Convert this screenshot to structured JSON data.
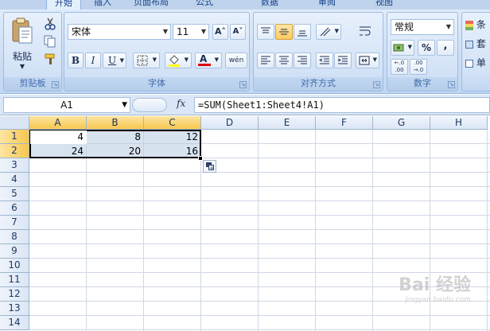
{
  "ribbon": {
    "tabs": [
      "开始",
      "插入",
      "页面布局",
      "公式",
      "数据",
      "审阅",
      "视图"
    ],
    "groups": {
      "clipboard": {
        "label": "剪贴板",
        "paste": "粘贴"
      },
      "font": {
        "label": "字体",
        "font_name": "宋体",
        "font_size": "11",
        "bold": "B",
        "italic": "I",
        "underline": "U",
        "grow": "A˄",
        "shrink": "A˅",
        "font_color": "A",
        "phonetic": "wén"
      },
      "alignment": {
        "label": "对齐方式"
      },
      "number": {
        "label": "数字",
        "format": "常规",
        "percent": "%",
        "comma": ",",
        "inc_decimal": "←.0 .00",
        "dec_decimal": ".00 →.0"
      },
      "styles": {
        "items": [
          "条",
          "套",
          "单"
        ]
      }
    }
  },
  "formula_bar": {
    "name_box": "A1",
    "fx": "fx",
    "formula": "=SUM(Sheet1:Sheet4!A1)"
  },
  "grid": {
    "columns": [
      "A",
      "B",
      "C",
      "D",
      "E",
      "F",
      "G",
      "H"
    ],
    "rows": [
      "1",
      "2",
      "3",
      "4",
      "5",
      "6",
      "7",
      "8",
      "9",
      "10",
      "11",
      "12",
      "13",
      "14"
    ],
    "cells": {
      "A1": "4",
      "B1": "8",
      "C1": "12",
      "A2": "24",
      "B2": "20",
      "C2": "16"
    }
  },
  "watermark": {
    "text": "Bai 经验",
    "sub": "jingyan.baidu.com"
  }
}
